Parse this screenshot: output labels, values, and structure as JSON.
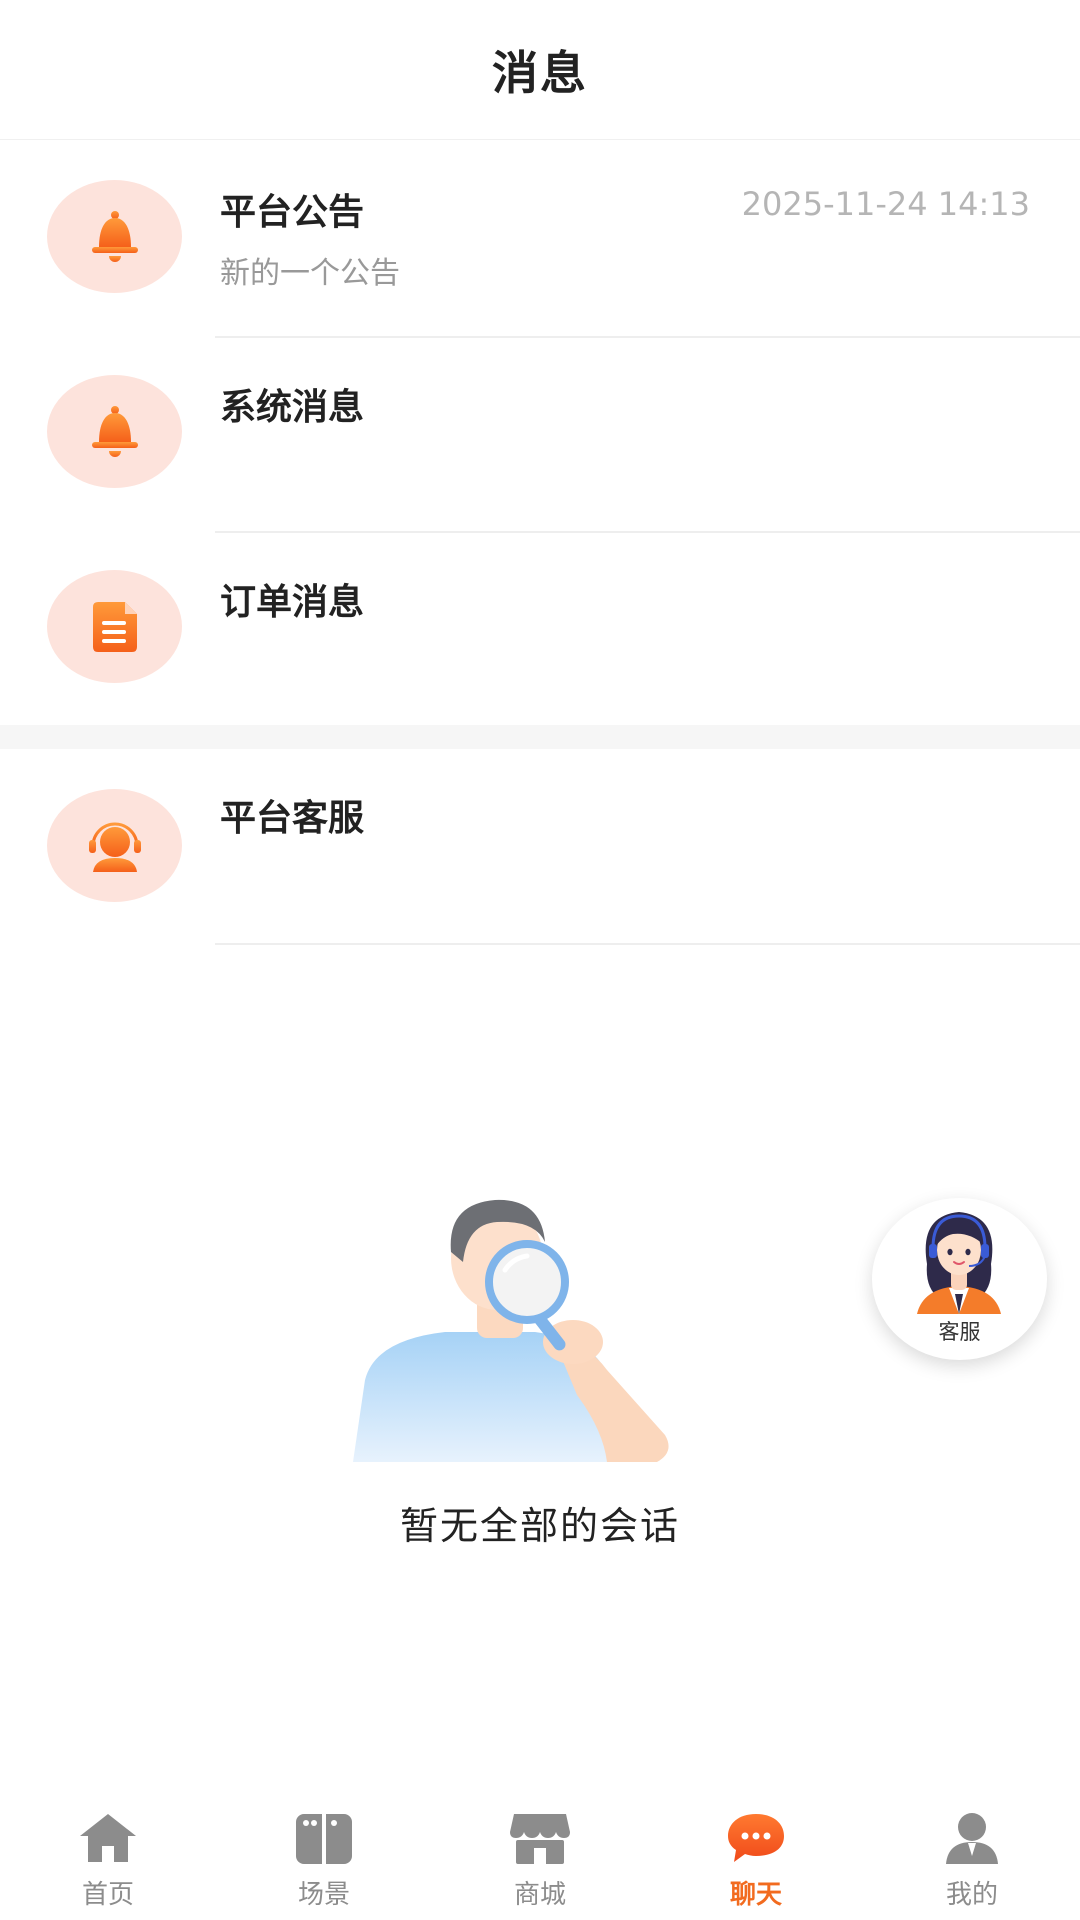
{
  "header": {
    "title": "消息"
  },
  "messages": [
    {
      "name": "平台公告",
      "preview": "新的一个公告",
      "time": "2025-11-24 14:13",
      "icon": "bell-icon"
    },
    {
      "name": "系统消息",
      "preview": "",
      "time": "",
      "icon": "bell-icon"
    },
    {
      "name": "订单消息",
      "preview": "",
      "time": "",
      "icon": "document-icon"
    }
  ],
  "service": {
    "name": "平台客服",
    "icon": "agent-icon"
  },
  "empty_state": {
    "text": "暂无全部的会话",
    "icon": "magnifier-person-illustration"
  },
  "floating_service": {
    "label": "客服",
    "icon": "customer-service-avatar"
  },
  "tabbar": {
    "items": [
      {
        "label": "首页",
        "icon": "home-icon"
      },
      {
        "label": "场景",
        "icon": "scene-icon"
      },
      {
        "label": "商城",
        "icon": "shop-icon"
      },
      {
        "label": "聊天",
        "icon": "chat-icon",
        "active": true
      },
      {
        "label": "我的",
        "icon": "user-icon"
      }
    ]
  },
  "colors": {
    "accent": "#f26b1f",
    "icon_bg": "#fde3dc",
    "inactive": "#8c8c8c"
  }
}
